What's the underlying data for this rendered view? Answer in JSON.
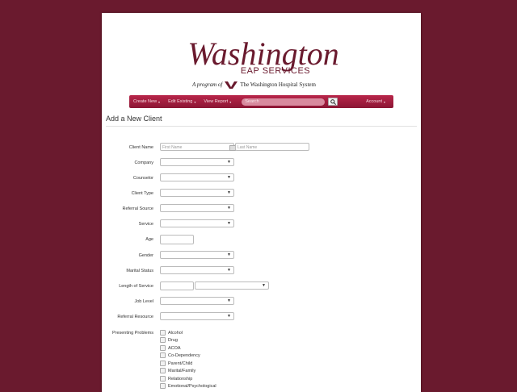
{
  "brand": {
    "script": "Washington",
    "subtitle": "EAP SERVICES",
    "tagline_pre": "A program of",
    "tagline_post": "The Washington Hospital System",
    "color": "#6a1a2e"
  },
  "nav": {
    "items": [
      {
        "label": "Create New"
      },
      {
        "label": "Edit Existing"
      },
      {
        "label": "View Report"
      }
    ],
    "search_placeholder": "Search",
    "account": "Account",
    "color": "#9d1d3e"
  },
  "page_title": "Add a New Client",
  "form": {
    "client_name_label": "Client Name",
    "first_name_placeholder": "First Name",
    "last_name_placeholder": "Last Name",
    "company": "Company",
    "counselor": "Counselor",
    "client_type": "Client Type",
    "referral_source": "Referral Source",
    "service": "Service",
    "age": "Age",
    "gender": "Gender",
    "marital_status": "Marital Status",
    "length_of_service": "Length of Service",
    "job_level": "Job Level",
    "referral_resource": "Referral Resource",
    "presenting_problems": "Presenting Problems",
    "problems": [
      "Alcohol",
      "Drug",
      "ACOA",
      "Co-Dependency",
      "Parent/Child",
      "Marital/Family",
      "Relationship",
      "Emotional/Psychological"
    ]
  }
}
